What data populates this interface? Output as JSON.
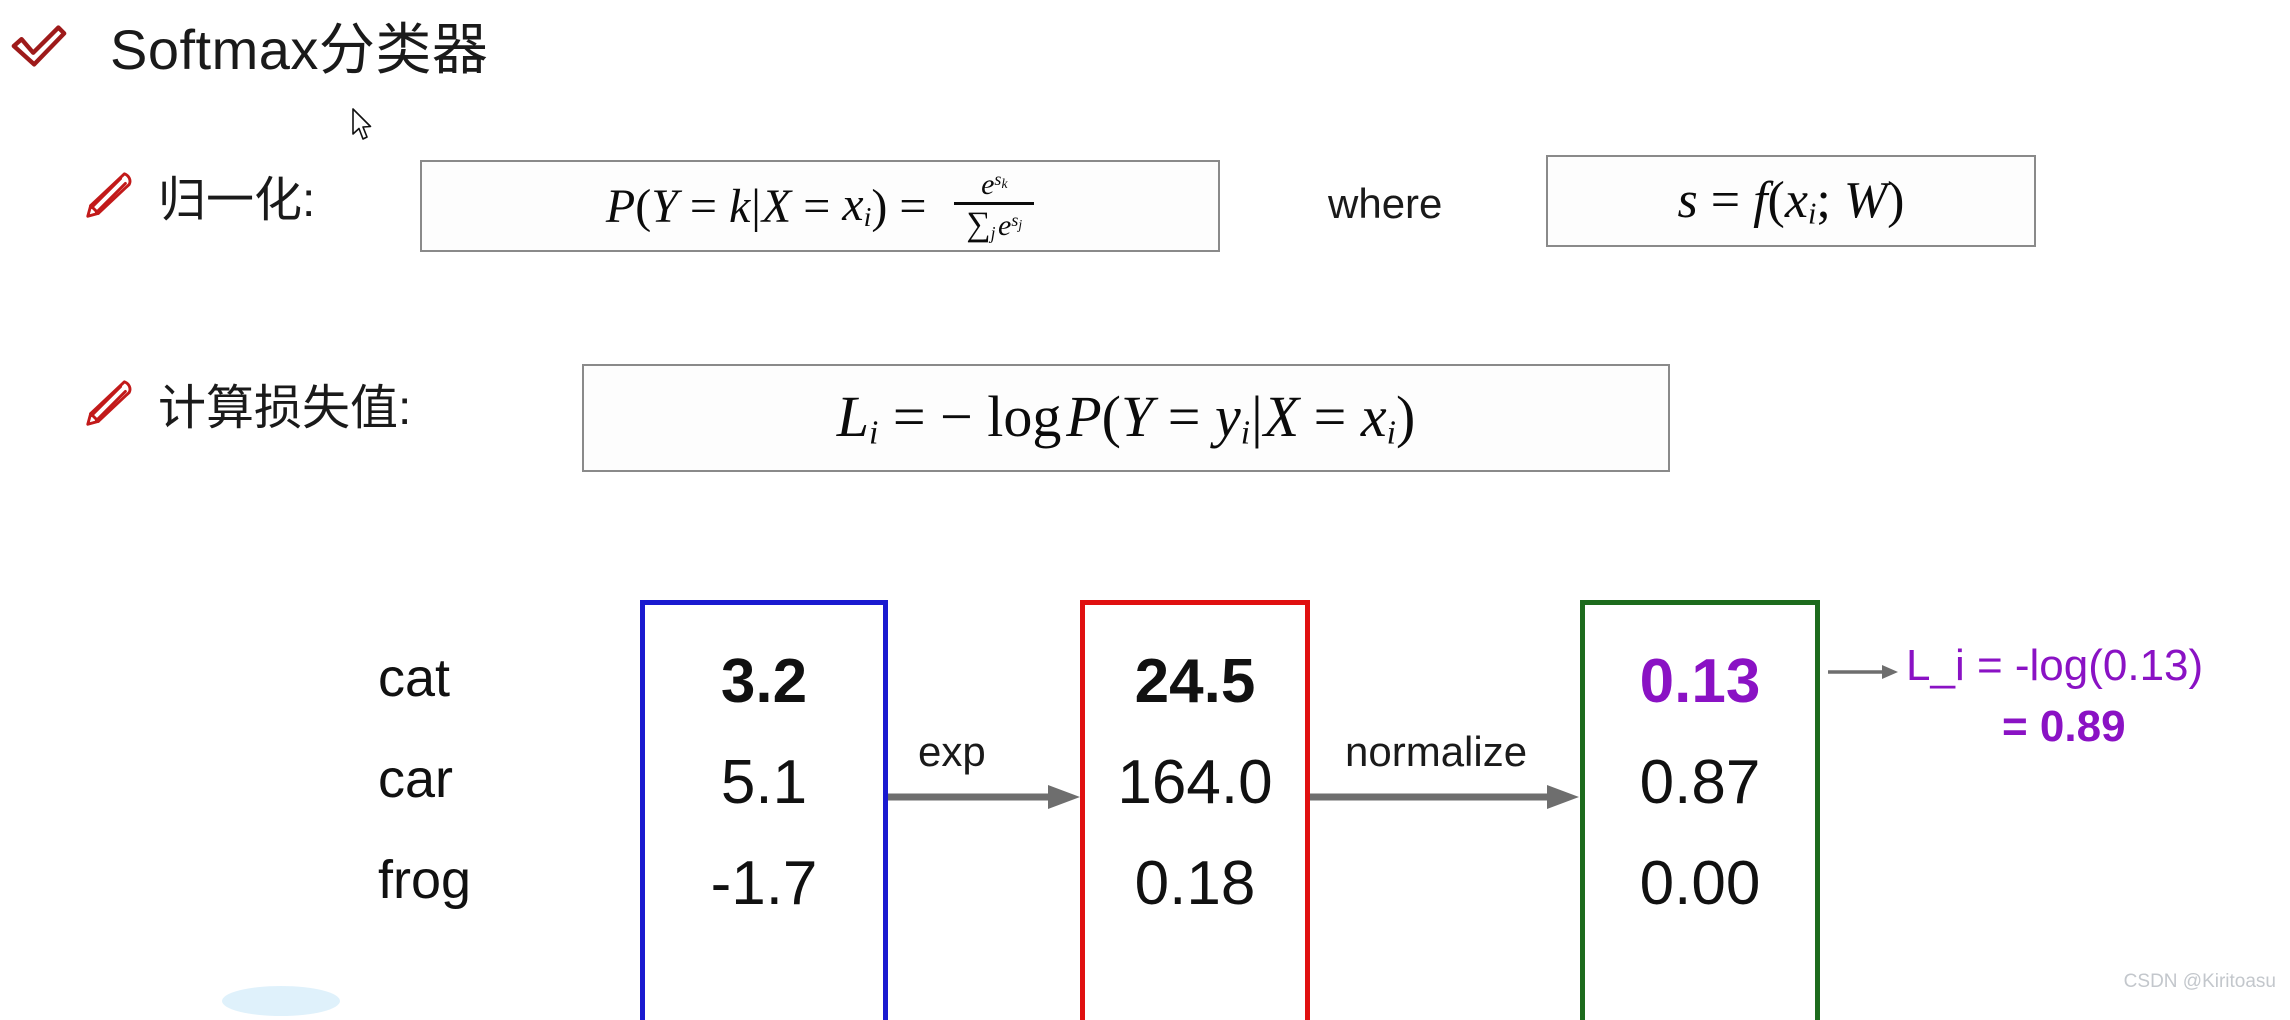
{
  "slide": {
    "title": "Softmax分类器",
    "check_icon": "check-icon",
    "cursor_icon": "mouse-cursor-icon"
  },
  "bullets": [
    {
      "icon": "pencil-icon",
      "label": "归一化:",
      "formula_plain": "P(Y = k|X = x_i) = e^{s_k} / Σ_j e^{s_j}",
      "parts": {
        "lhs_P": "P",
        "lhs_open": "(",
        "lhs_Y": "Y",
        "eq1": " = ",
        "lhs_k": "k",
        "bar": "|",
        "lhs_X": "X",
        "eq2": " = ",
        "lhs_x": "x",
        "lhs_x_sub": "i",
        "lhs_close": ")",
        "eq3": " = ",
        "num_e": "e",
        "num_sup_s": "s",
        "num_sup_sub": "k",
        "den_sigma": "∑",
        "den_sigma_sub": "j",
        "den_e": "e",
        "den_sup_s": "s",
        "den_sup_sub": "j"
      },
      "where_label": "where",
      "where_formula_plain": "s = f(x_i; W)",
      "where_parts": {
        "s": "s",
        "eq": " = ",
        "f": "f",
        "open": "(",
        "x": "x",
        "x_sub": "i",
        "semi": "; ",
        "W": "W",
        "close": ")"
      }
    },
    {
      "icon": "pencil-icon",
      "label": "计算损失值:",
      "formula_plain": "L_i = − log P(Y = y_i|X = x_i)",
      "parts": {
        "L": "L",
        "L_sub": "i",
        "eq": " = ",
        "minus": "− ",
        "log": "log",
        "P": "P",
        "open": "(",
        "Y": "Y",
        "eq2": " = ",
        "y": "y",
        "y_sub": "i",
        "bar": "|",
        "X": "X",
        "eq3": " = ",
        "x": "x",
        "x_sub": "i",
        "close": ")"
      }
    }
  ],
  "diagram": {
    "class_labels": [
      "cat",
      "car",
      "frog"
    ],
    "columns": [
      {
        "name": "scores",
        "border_color": "#1a1ad0",
        "values": [
          "3.2",
          "5.1",
          "-1.7"
        ],
        "emphasis_index": 0
      },
      {
        "name": "unnormalized-probabilities",
        "border_color": "#e01010",
        "values": [
          "24.5",
          "164.0",
          "0.18"
        ],
        "emphasis_index": 0
      },
      {
        "name": "probabilities",
        "border_color": "#1d6b1d",
        "values": [
          "0.13",
          "0.87",
          "0.00"
        ],
        "emphasis_index": 0,
        "emphasis_color": "#8a12c4"
      }
    ],
    "arrows": [
      {
        "name": "exp-arrow",
        "label": "exp"
      },
      {
        "name": "normalize-arrow",
        "label": "normalize"
      }
    ],
    "loss_annotation": {
      "line1": "L_i = -log(0.13)",
      "line2": "= 0.89",
      "color": "#8a12c4"
    }
  },
  "watermark": "CSDN @Kiritoasu",
  "colors": {
    "check": "#9e1a1a",
    "pencil": "#c21a1a",
    "scores_box": "#1a1ad0",
    "exp_box": "#e01010",
    "probs_box": "#1d6b1d",
    "accent_purple": "#8a12c4",
    "arrow_gray": "#6e6e6e",
    "formula_border": "#8a8a8a"
  }
}
